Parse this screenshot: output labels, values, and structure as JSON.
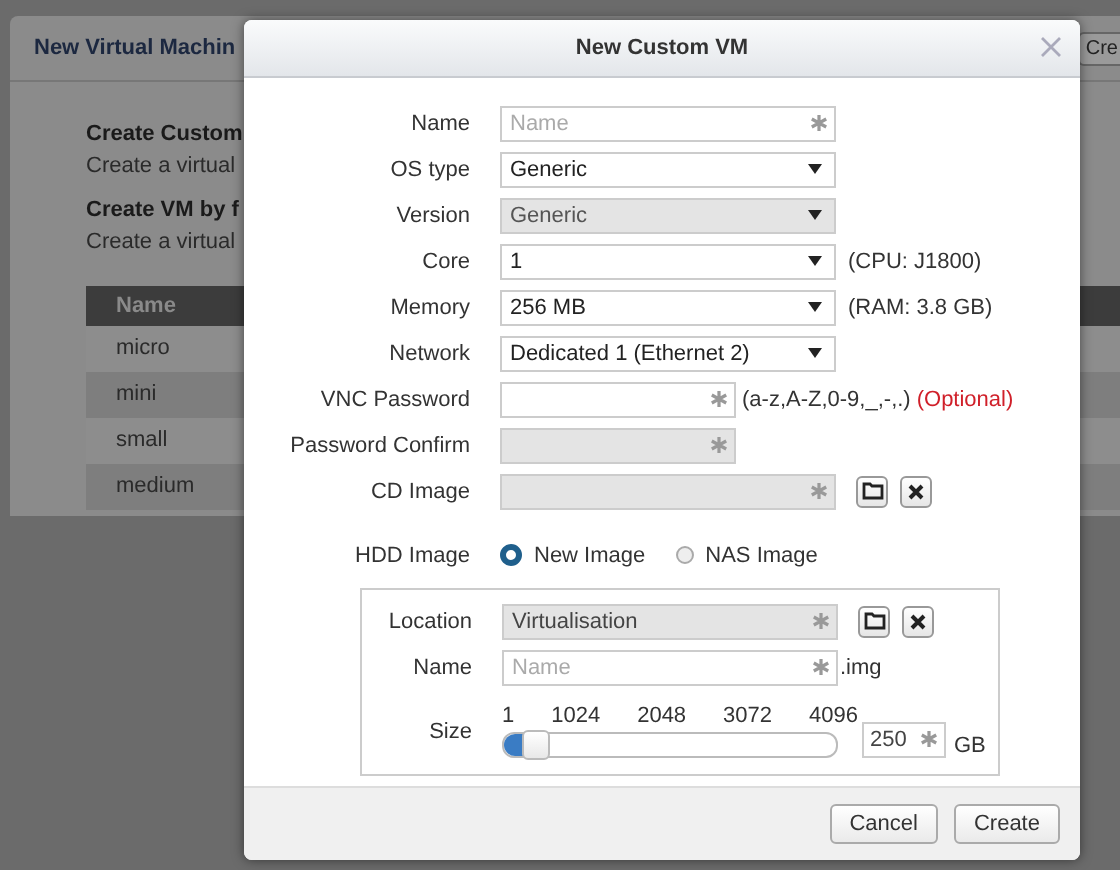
{
  "background": {
    "title": "New Virtual Machin",
    "create_button": "Cre",
    "sections": [
      {
        "heading": "Create Custom",
        "text": "Create a virtual"
      },
      {
        "heading": "Create VM by f",
        "text": "Create a virtual"
      }
    ],
    "table": {
      "columns": [
        "Name"
      ],
      "rows": [
        "micro",
        "mini",
        "small",
        "medium"
      ]
    }
  },
  "dialog": {
    "title": "New Custom VM",
    "fields": [
      {
        "label": "Name",
        "kind": "text",
        "placeholder": "Name",
        "disabled": false
      },
      {
        "label": "OS type",
        "kind": "select",
        "value": "Generic",
        "disabled": false
      },
      {
        "label": "Version",
        "kind": "select",
        "value": "Generic",
        "disabled": true
      },
      {
        "label": "Core",
        "kind": "select",
        "value": "1",
        "disabled": false,
        "note": "(CPU: J1800)"
      },
      {
        "label": "Memory",
        "kind": "select",
        "value": "256 MB",
        "disabled": false,
        "note": "(RAM: 3.8 GB)"
      },
      {
        "label": "Network",
        "kind": "select",
        "value": "Dedicated 1 (Ethernet 2)",
        "disabled": false
      },
      {
        "label": "VNC Password",
        "kind": "password",
        "disabled": false,
        "note": "(a-z,A-Z,0-9,_,-,.)",
        "optional": "(Optional)"
      },
      {
        "label": "Password Confirm",
        "kind": "password",
        "disabled": true
      },
      {
        "label": "CD Image",
        "kind": "file",
        "disabled": true
      }
    ],
    "hdd": {
      "label": "HDD Image",
      "options": [
        {
          "label": "New Image",
          "selected": true
        },
        {
          "label": "NAS Image",
          "selected": false
        }
      ],
      "location": {
        "label": "Location",
        "value": "Virtualisation"
      },
      "name": {
        "label": "Name",
        "placeholder": "Name",
        "suffix": ".img"
      },
      "size": {
        "label": "Size",
        "ticks": [
          "1",
          "1024",
          "2048",
          "3072",
          "4096"
        ],
        "level": 0.06,
        "value": "250",
        "unit": "GB"
      }
    },
    "buttons": [
      "Cancel",
      "Create"
    ]
  }
}
